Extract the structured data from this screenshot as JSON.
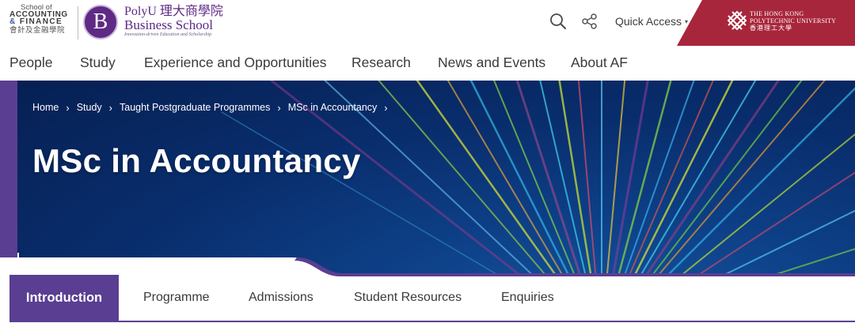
{
  "header": {
    "school_logo": {
      "line1": "School of",
      "line2": "ACCOUNTING",
      "line3_amp": "&",
      "line3": "FINANCE",
      "line4": "會計及金融學院"
    },
    "business_school_logo": {
      "badge": "B",
      "line1": "PolyU 理大商學院",
      "line2": "Business School",
      "tagline": "Innovation-driven Education and Scholarship"
    },
    "search_icon": "search-icon",
    "share_icon": "share-icon",
    "quick_access_label": "Quick Access",
    "quick_access_caret": "▾",
    "university": {
      "line1": "The Hong Kong",
      "line2": "Polytechnic University",
      "line3": "香港理工大學",
      "color": "#a8263b"
    }
  },
  "nav": {
    "items": [
      {
        "label": "People"
      },
      {
        "label": "Study"
      },
      {
        "label": "Experience and Opportunities"
      },
      {
        "label": "Research"
      },
      {
        "label": "News and Events"
      },
      {
        "label": "About AF"
      }
    ]
  },
  "hero": {
    "breadcrumb": [
      {
        "label": "Home"
      },
      {
        "label": "Study"
      },
      {
        "label": "Taught Postgraduate Programmes"
      },
      {
        "label": "MSc in Accountancy"
      }
    ],
    "separator": "›",
    "title": "MSc in Accountancy"
  },
  "tabs": {
    "items": [
      {
        "label": "Introduction",
        "active": true
      },
      {
        "label": "Programme",
        "active": false
      },
      {
        "label": "Admissions",
        "active": false
      },
      {
        "label": "Student Resources",
        "active": false
      },
      {
        "label": "Enquiries",
        "active": false
      }
    ]
  },
  "colors": {
    "brand_purple": "#5a3e92",
    "polyu_red": "#a8263b",
    "hero_blue": "#0a3576"
  }
}
